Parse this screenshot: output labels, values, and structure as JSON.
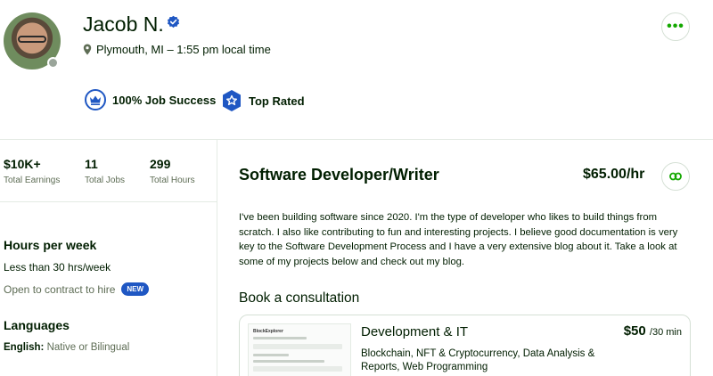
{
  "profile": {
    "name": "Jacob N.",
    "location": "Plymouth, MI – 1:55 pm local time",
    "badges": {
      "job_success": "100% Job Success",
      "top_rated": "Top Rated"
    }
  },
  "stats": [
    {
      "value": "$10K+",
      "label": "Total Earnings"
    },
    {
      "value": "11",
      "label": "Total Jobs"
    },
    {
      "value": "299",
      "label": "Total Hours"
    }
  ],
  "sidebar": {
    "hours_title": "Hours per week",
    "hours_value": "Less than 30 hrs/week",
    "contract_to_hire": "Open to contract to hire",
    "new_badge": "NEW",
    "languages_title": "Languages",
    "language_name": "English:",
    "language_level": "Native or Bilingual"
  },
  "main": {
    "title": "Software Developer/Writer",
    "rate": "$65.00/hr",
    "overview": "I've been building software since 2020. I'm the type of developer who likes to build things from scratch. I also like contributing to fun and interesting projects. I believe good documentation is very key to the Software Development Process and I have a very extensive blog about it. Take a look at some of my projects below and check out my blog.",
    "consultation_title": "Book a consultation",
    "consultation": {
      "category": "Development & IT",
      "price": "$50",
      "price_unit": "/30 min",
      "skills": "Blockchain, NFT & Cryptocurrency, Data Analysis & Reports, Web Programming",
      "thumbnail_title": "BlockExplorer"
    }
  },
  "colors": {
    "brand_green": "#14a800",
    "verified_blue": "#1f57c3",
    "text": "#001e00",
    "muted": "#5e6d55"
  },
  "icons": [
    "verified-icon",
    "location-pin-icon",
    "more-icon",
    "crown-icon",
    "star-badge-icon",
    "link-icon"
  ]
}
